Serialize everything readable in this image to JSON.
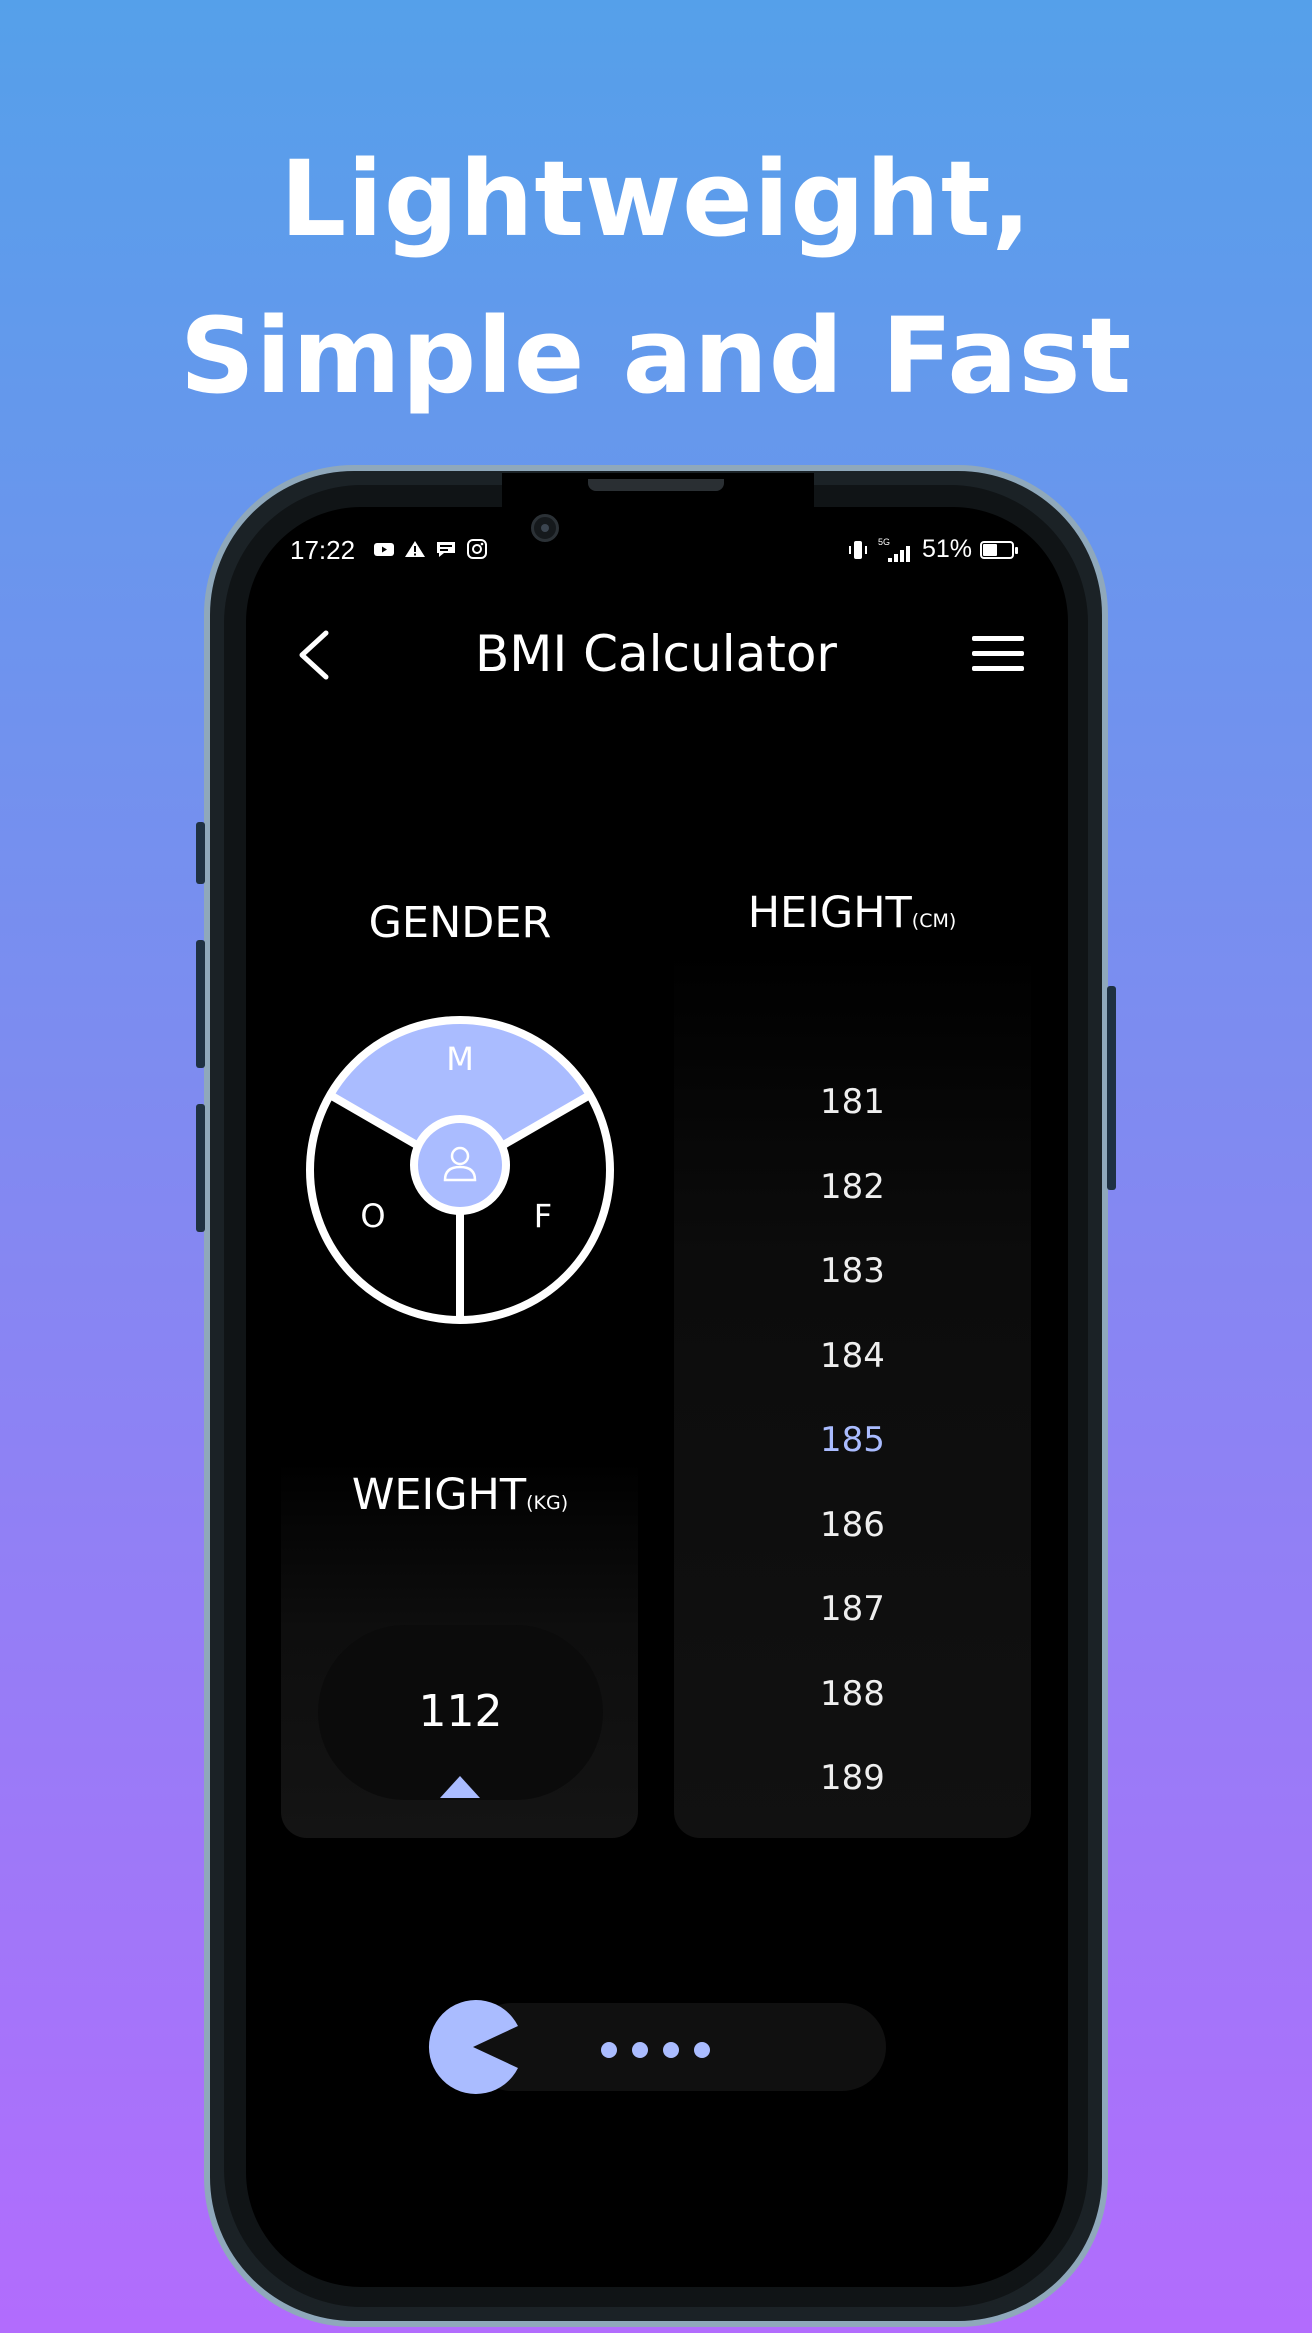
{
  "headline": {
    "line1": "Lightweight,",
    "line2": "Simple and Fast"
  },
  "status_bar": {
    "time": "17:22",
    "notification_icons": [
      "youtube-icon",
      "alert-icon",
      "message-icon",
      "instagram-icon"
    ],
    "network": "5G",
    "battery_percent": "51%",
    "battery_level": 0.51
  },
  "app_bar": {
    "title": "BMI Calculator"
  },
  "gender": {
    "label": "GENDER",
    "options": [
      "M",
      "F",
      "O"
    ],
    "selected": "M"
  },
  "height": {
    "label": "HEIGHT",
    "unit": "(CM)",
    "values": [
      "181",
      "182",
      "183",
      "184",
      "185",
      "186",
      "187",
      "188",
      "189"
    ],
    "selected": "185"
  },
  "weight": {
    "label": "WEIGHT",
    "unit": "(KG)",
    "value": "112"
  },
  "colors": {
    "accent": "#aabcff",
    "background_top": "#55a0ea",
    "background_bottom": "#b26cfd",
    "screen": "#000000"
  }
}
